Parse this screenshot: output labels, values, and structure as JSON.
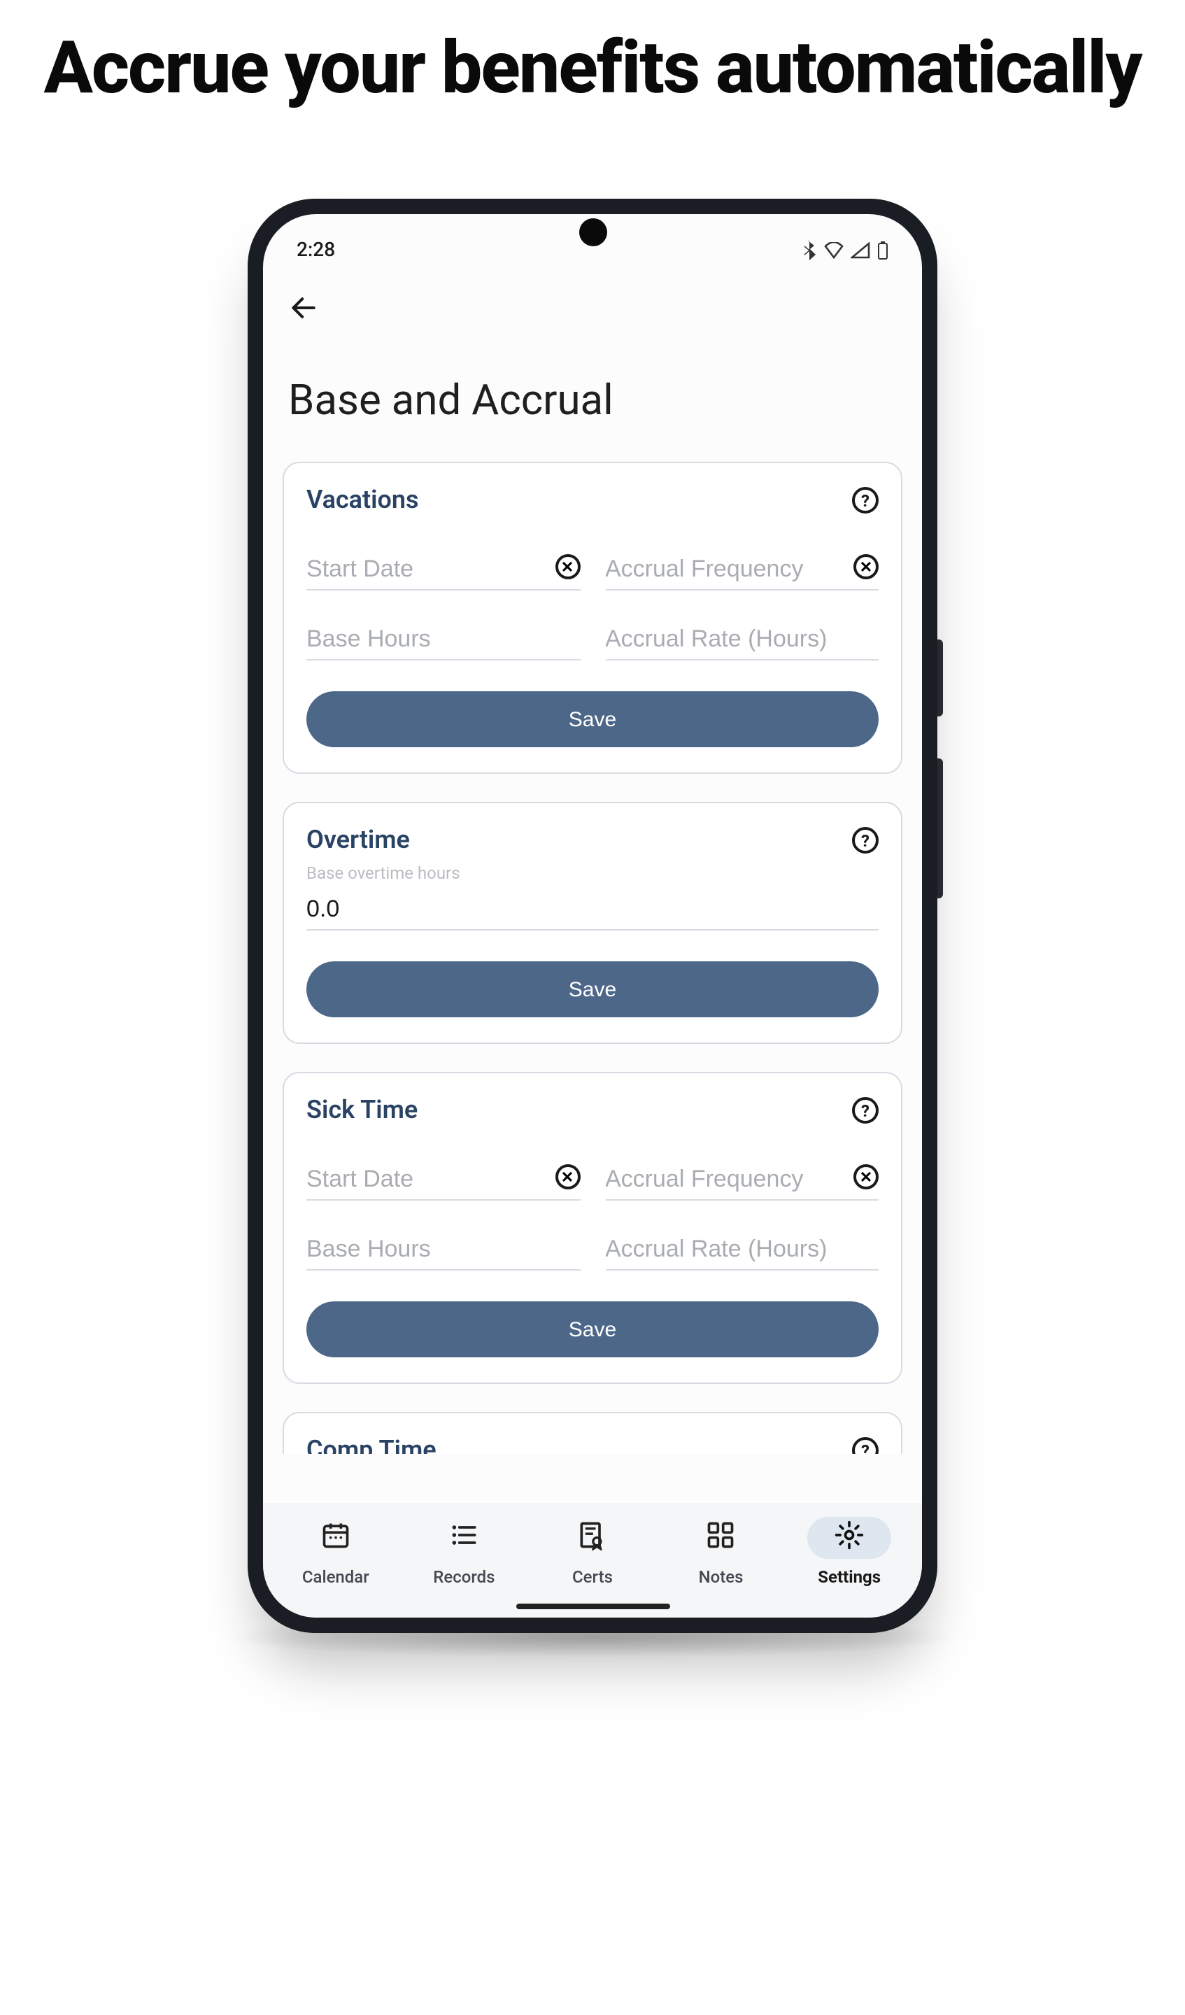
{
  "headline": "Accrue your benefits automatically",
  "status": {
    "time": "2:28"
  },
  "page_title": "Base and Accrual",
  "cards": {
    "vacations": {
      "title": "Vacations",
      "start_date_ph": "Start Date",
      "accrual_freq_ph": "Accrual Frequency",
      "base_hours_ph": "Base Hours",
      "accrual_rate_ph": "Accrual Rate (Hours)",
      "save_label": "Save"
    },
    "overtime": {
      "title": "Overtime",
      "label": "Base overtime hours",
      "value": "0.0",
      "save_label": "Save"
    },
    "sick": {
      "title": "Sick Time",
      "start_date_ph": "Start Date",
      "accrual_freq_ph": "Accrual Frequency",
      "base_hours_ph": "Base Hours",
      "accrual_rate_ph": "Accrual Rate (Hours)",
      "save_label": "Save"
    },
    "comp": {
      "title": "Comp Time"
    }
  },
  "nav": {
    "calendar": "Calendar",
    "records": "Records",
    "certs": "Certs",
    "notes": "Notes",
    "settings": "Settings"
  }
}
